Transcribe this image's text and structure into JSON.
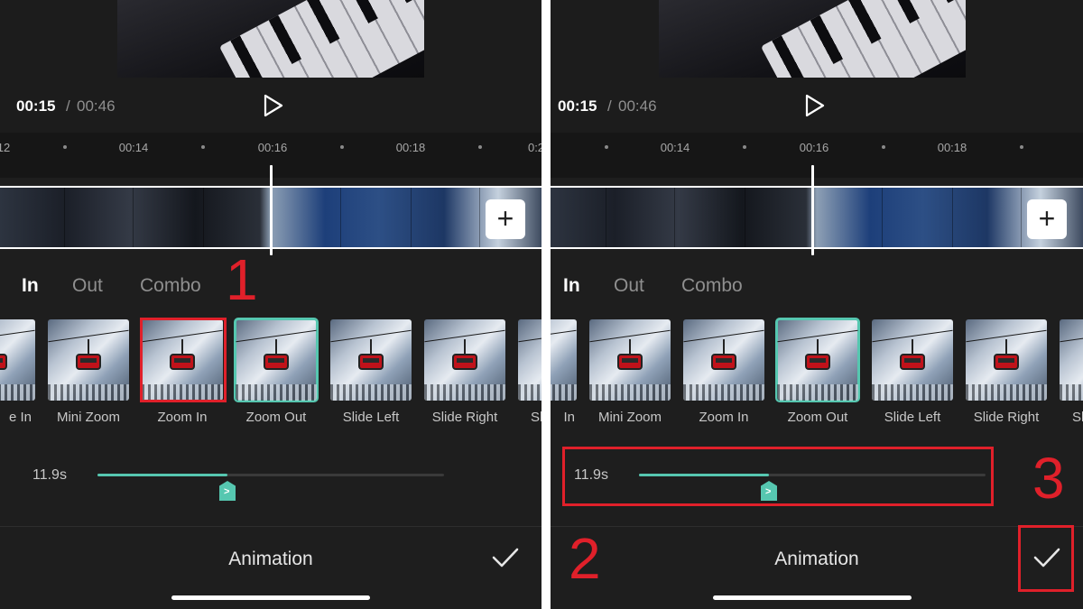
{
  "playback": {
    "current_time": "00:15",
    "separator": "/",
    "total_time": "00:46"
  },
  "timeline": {
    "ticks": [
      "12",
      "00:14",
      "00:16",
      "00:18",
      "0:2"
    ],
    "ticks_right": [
      "00:14",
      "00:16",
      "00:18"
    ]
  },
  "add_button": "+",
  "tabs": [
    {
      "label": "In",
      "active": true
    },
    {
      "label": "Out",
      "active": false
    },
    {
      "label": "Combo",
      "active": false
    }
  ],
  "effects": [
    {
      "label": "e In"
    },
    {
      "label": "Mini Zoom"
    },
    {
      "label": "Zoom In"
    },
    {
      "label": "Zoom Out",
      "selected": true
    },
    {
      "label": "Slide Left"
    },
    {
      "label": "Slide Right"
    },
    {
      "label": "Sl"
    }
  ],
  "effects_right_first": "In",
  "effects_right_last": "Sl",
  "duration": {
    "label": "11.9s",
    "fraction": 0.375,
    "thumb_glyph": ">"
  },
  "bottom": {
    "title": "Animation"
  },
  "annotations": {
    "one": "1",
    "two": "2",
    "three": "3"
  },
  "colors": {
    "accent": "#56c7b0",
    "annotation": "#e0202a",
    "background": "#1e1e1e"
  }
}
